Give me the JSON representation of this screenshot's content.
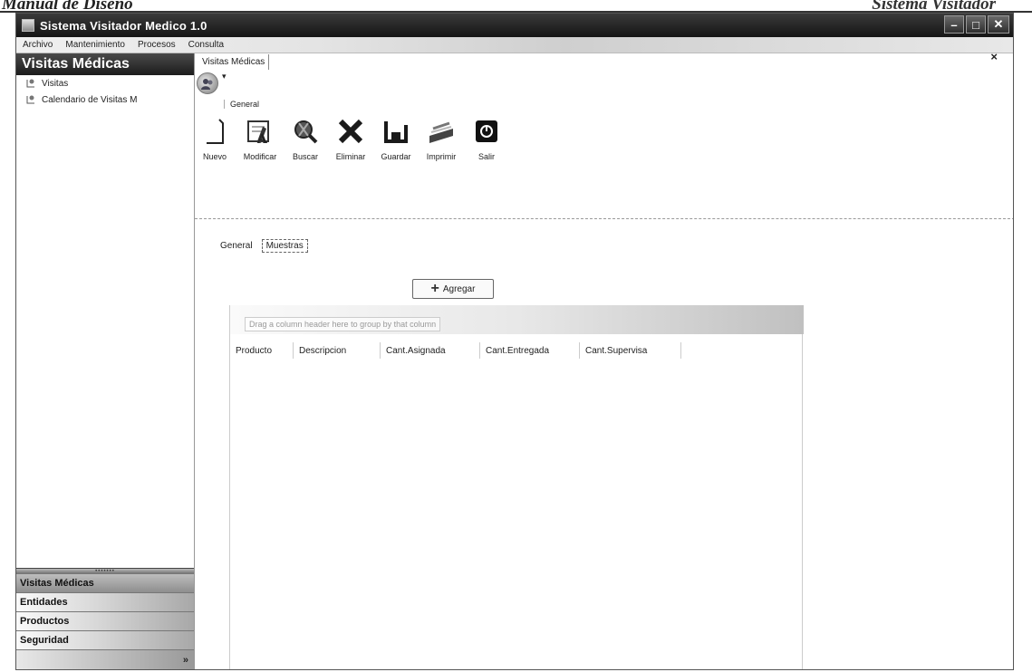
{
  "doc_header": {
    "left": "Manual de Diseño",
    "right": "Sistema Visitador"
  },
  "window": {
    "title": "Sistema Visitador Medico 1.0",
    "controls": {
      "minimize": "–",
      "maximize": "□",
      "close": "✕"
    }
  },
  "menu": {
    "items": [
      "Archivo",
      "Mantenimiento",
      "Procesos",
      "Consulta"
    ],
    "close": "×"
  },
  "sidebar": {
    "header": "Visitas Médicas",
    "items": [
      {
        "label": "Visitas",
        "icon": "tree-node-icon"
      },
      {
        "label": "Calendario de Visitas M",
        "icon": "tree-node-icon"
      }
    ],
    "groups": [
      "Visitas Médicas",
      "Entidades",
      "Productos",
      "Seguridad"
    ],
    "bottom_chevron": "»"
  },
  "main": {
    "doc_tab": "Visitas Médicas",
    "quick_access": "▾",
    "ribbon_tab": "General",
    "toolbar": [
      {
        "label": "Nuevo",
        "icon": "new-document-icon"
      },
      {
        "label": "Modificar",
        "icon": "edit-icon"
      },
      {
        "label": "Buscar",
        "icon": "search-icon"
      },
      {
        "label": "Eliminar",
        "icon": "delete-icon"
      },
      {
        "label": "Guardar",
        "icon": "save-icon"
      },
      {
        "label": "Imprimir",
        "icon": "print-icon"
      },
      {
        "label": "Salir",
        "icon": "exit-icon"
      }
    ],
    "form_tabs": [
      "General",
      "Muestras"
    ],
    "active_form_tab": "Muestras",
    "add_button": "Agregar",
    "grid": {
      "group_hint": "Drag a column header here to group by that column",
      "columns": [
        "Producto",
        "Descripcion",
        "Cant.Asignada",
        "Cant.Entregada",
        "Cant.Supervisa"
      ]
    }
  }
}
